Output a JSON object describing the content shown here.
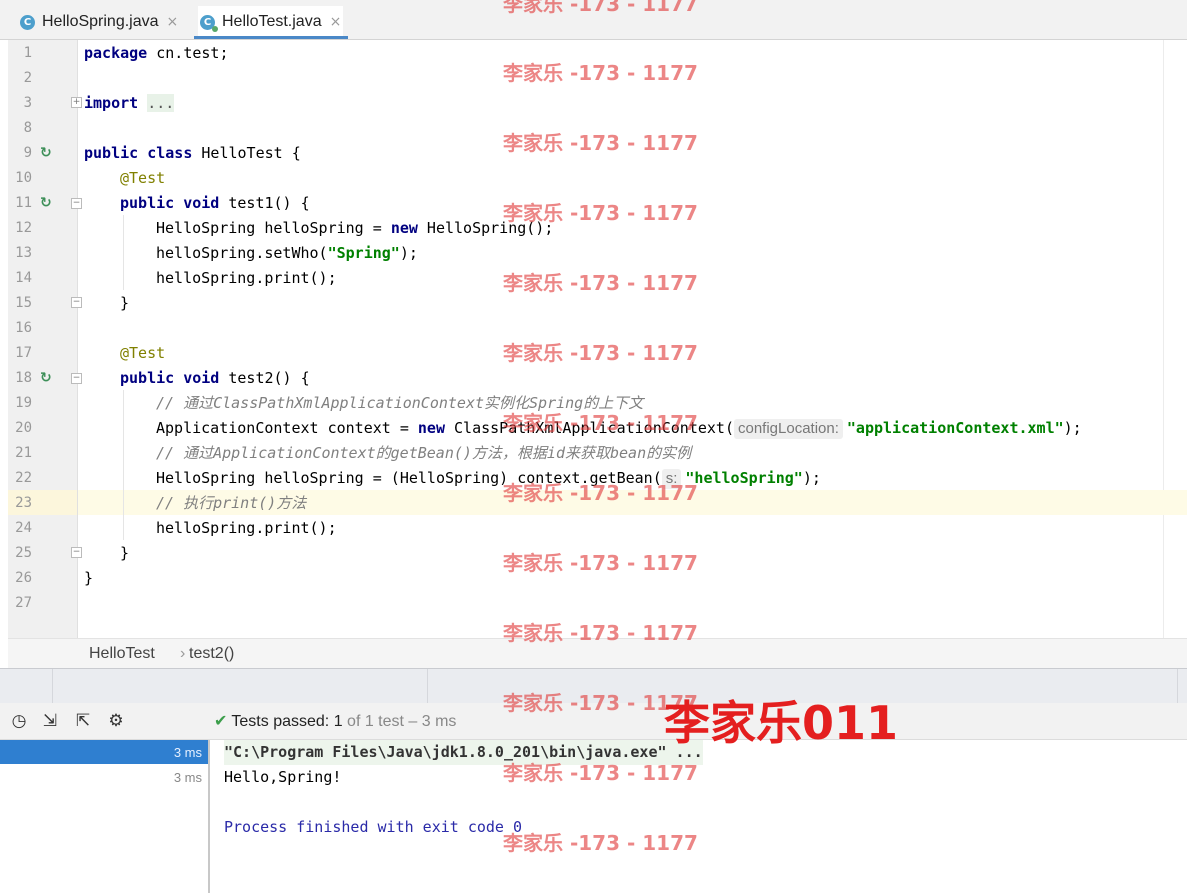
{
  "tabs": [
    {
      "label": "HelloSpring.java",
      "icon": "C",
      "active": false
    },
    {
      "label": "HelloTest.java",
      "icon": "C",
      "active": true
    }
  ],
  "close_glyph": "×",
  "code_lines": [
    {
      "n": "1"
    },
    {
      "n": "2"
    },
    {
      "n": "3"
    },
    {
      "n": "8"
    },
    {
      "n": "9"
    },
    {
      "n": "10"
    },
    {
      "n": "11"
    },
    {
      "n": "12"
    },
    {
      "n": "13"
    },
    {
      "n": "14"
    },
    {
      "n": "15"
    },
    {
      "n": "16"
    },
    {
      "n": "17"
    },
    {
      "n": "18"
    },
    {
      "n": "19"
    },
    {
      "n": "20"
    },
    {
      "n": "21"
    },
    {
      "n": "22"
    },
    {
      "n": "23"
    },
    {
      "n": "24"
    },
    {
      "n": "25"
    },
    {
      "n": "26"
    },
    {
      "n": "27"
    }
  ],
  "code": {
    "l1_kw": "package",
    "l1_rest": " cn.test;",
    "l3_kw": "import",
    "l3_fold": "...",
    "l9_kw1": "public",
    "l9_kw2": "class",
    "l9_rest": " HelloTest {",
    "l10_ann": "@Test",
    "l11_kw1": "public",
    "l11_kw2": "void",
    "l11_rest": " test1() {",
    "l12_a": "HelloSpring helloSpring = ",
    "l12_kw": "new",
    "l12_b": " HelloSpring();",
    "l13_a": "helloSpring.setWho(",
    "l13_str": "\"Spring\"",
    "l13_b": ");",
    "l14": "helloSpring.print();",
    "l15": "}",
    "l17_ann": "@Test",
    "l18_kw1": "public",
    "l18_kw2": "void",
    "l18_rest": " test2() {",
    "l19_cmt": "// 通过ClassPathXmlApplicationContext实例化Spring的上下文",
    "l20_a": "ApplicationContext context = ",
    "l20_kw": "new",
    "l20_b": " ClassPathXmlApplicationContext(",
    "l20_hint": "configLocation:",
    "l20_str": "\"applicationContext.xml\"",
    "l20_c": ");",
    "l21_cmt": "// 通过ApplicationContext的getBean()方法，根据id来获取bean的实例",
    "l22_a": "HelloSpring helloSpring = (HelloSpring) context.getBean(",
    "l22_hint": "s:",
    "l22_str": "\"helloSpring\"",
    "l22_b": ");",
    "l23_cmt": "// 执行print()方法",
    "l24": "helloSpring.print();",
    "l25": "}",
    "l26": "}"
  },
  "breadcrumb": {
    "class_name": "HelloTest",
    "separator": "›",
    "method_name": "test2()"
  },
  "run_toolbar": {
    "icons": [
      "history-icon",
      "import-tests-icon",
      "export-tests-icon",
      "settings-icon"
    ],
    "status_prefix": "Tests passed: ",
    "passed_count": "1",
    "status_suffix": " of 1 test – 3 ms"
  },
  "test_tree": [
    {
      "time": "3 ms",
      "selected": true
    },
    {
      "time": "3 ms",
      "selected": false
    }
  ],
  "console": {
    "command": "\"C:\\Program Files\\Java\\jdk1.8.0_201\\bin\\java.exe\" ...",
    "output": "Hello,Spring!",
    "exit": "Process finished with exit code 0"
  },
  "watermark_small": "李家乐 -173 - 1177",
  "watermark_big": "李家乐011",
  "colors": {
    "keyword": "#000080",
    "annotation": "#808000",
    "string": "#008000",
    "comment": "#808080",
    "selection": "#2f7fd0",
    "watermark": "#e41f1f"
  }
}
